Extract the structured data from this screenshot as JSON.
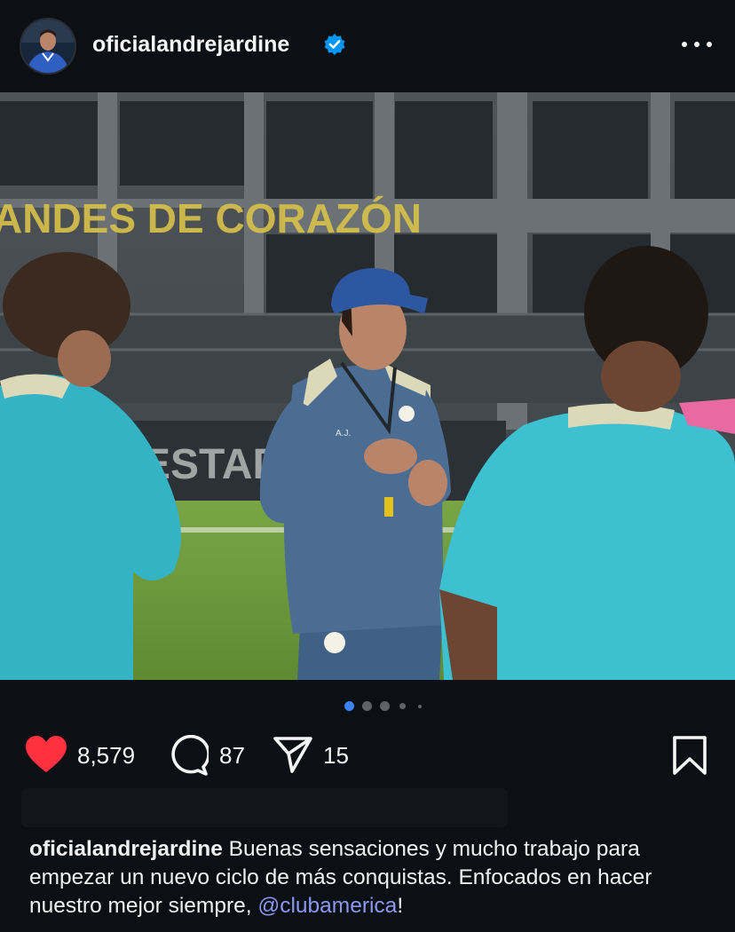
{
  "post": {
    "username": "oficialandrejardine",
    "verified": true,
    "avatar_icon": "profile-avatar",
    "more_icon": "more-options-icon"
  },
  "photo": {
    "banner_text": "ANDES DE CORAZÓN",
    "stadium_text": "ESTADIO",
    "shirt_initials": "A.J.",
    "colors": {
      "sky": "#5a5f63",
      "building": "#2b3034",
      "pitch": "#6f9a3c",
      "teal_kit": "#34b3c4",
      "navy_kit": "#4b6d93",
      "cap": "#2e57a1",
      "banner": "#d8c24a"
    }
  },
  "carousel": {
    "count": 5,
    "active": 0
  },
  "actions": {
    "likes": "8,579",
    "comments": "87",
    "shares": "15",
    "like_color": "#ff3040"
  },
  "caption": {
    "username": "oficialandrejardine",
    "text": " Buenas sensaciones y mucho trabajo para empezar un nuevo ciclo de más conquistas. Enfocados en hacer nuestro mejor siempre, ",
    "mention": "@clubamerica",
    "end": "!",
    "mention_color": "#8b98f0"
  }
}
